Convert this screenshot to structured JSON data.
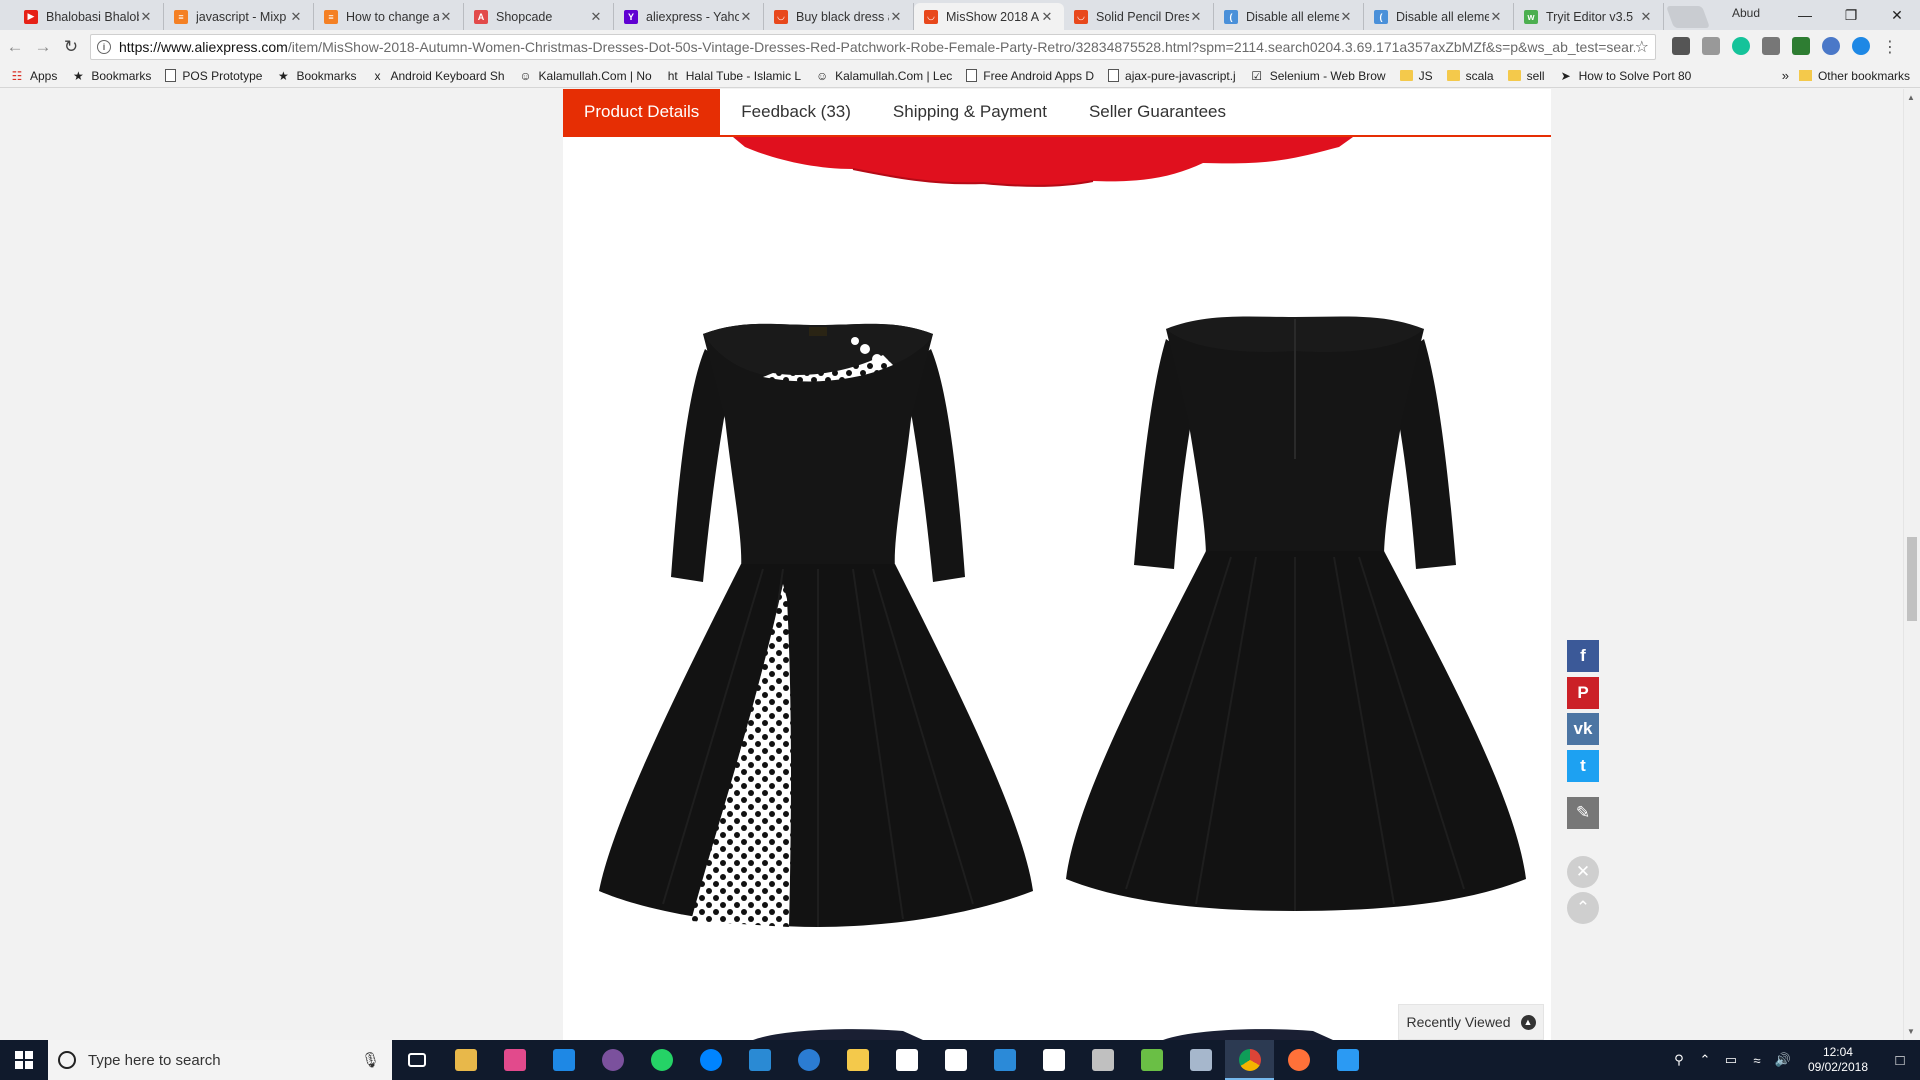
{
  "browser": {
    "tabs": [
      {
        "title": "Bhalobasi Bhalob",
        "color": "#e62117",
        "glyph": "▶"
      },
      {
        "title": "javascript - Mixp",
        "color": "#f48024",
        "glyph": "≡"
      },
      {
        "title": "How to change a",
        "color": "#f48024",
        "glyph": "≡"
      },
      {
        "title": "Shopcade",
        "color": "#e24a4a",
        "glyph": "A"
      },
      {
        "title": "aliexpress - Yaho",
        "color": "#6001d2",
        "glyph": "Y"
      },
      {
        "title": "Buy black dress a",
        "color": "#e8481c",
        "glyph": "◡"
      },
      {
        "title": "MisShow 2018 A",
        "color": "#e8481c",
        "glyph": "◡"
      },
      {
        "title": "Solid Pencil Dres",
        "color": "#e8481c",
        "glyph": "◡"
      },
      {
        "title": "Disable all eleme",
        "color": "#4a90d9",
        "glyph": "("
      },
      {
        "title": "Disable all eleme",
        "color": "#4a90d9",
        "glyph": "("
      },
      {
        "title": "Tryit Editor v3.5",
        "color": "#4caf50",
        "glyph": "w"
      }
    ],
    "active_tab_index": 6,
    "user": "Abud",
    "url_host": "https://www.aliexpress.com",
    "url_rest": "/item/MisShow-2018-Autumn-Women-Christmas-Dresses-Dot-50s-Vintage-Dresses-Red-Patchwork-Robe-Female-Party-Retro/32834875528.html?spm=2114.search0204.3.69.171a357axZbMZf&s=p&ws_ab_test=sear...",
    "bookmarks": [
      {
        "label": "Apps",
        "icon": "apps-icon"
      },
      {
        "label": "Bookmarks",
        "icon": "star-icon"
      },
      {
        "label": "POS Prototype",
        "icon": "page-icon"
      },
      {
        "label": "Bookmarks",
        "icon": "star-icon"
      },
      {
        "label": "Android Keyboard Sh",
        "icon": "xda-icon"
      },
      {
        "label": "Kalamullah.Com | No",
        "icon": "kalam-icon"
      },
      {
        "label": "Halal Tube - Islamic L",
        "icon": "ht-icon"
      },
      {
        "label": "Kalamullah.Com | Lec",
        "icon": "kalam-icon"
      },
      {
        "label": "Free Android Apps D",
        "icon": "page-icon"
      },
      {
        "label": "ajax-pure-javascript.j",
        "icon": "page-icon"
      },
      {
        "label": "Selenium - Web Brow",
        "icon": "selenium-icon"
      },
      {
        "label": "JS",
        "icon": "folder-icon"
      },
      {
        "label": "scala",
        "icon": "folder-icon"
      },
      {
        "label": "sell",
        "icon": "folder-icon"
      },
      {
        "label": "How to Solve Port 80",
        "icon": "arrow-icon"
      }
    ],
    "bookmarks_more": "»",
    "other_bookmarks": "Other bookmarks"
  },
  "page": {
    "tabs": [
      {
        "label": "Product Details",
        "active": true
      },
      {
        "label": "Feedback (33)",
        "active": false
      },
      {
        "label": "Shipping & Payment",
        "active": false
      },
      {
        "label": "Seller Guarantees",
        "active": false
      }
    ],
    "recently_viewed": "Recently Viewed",
    "share": [
      {
        "name": "facebook",
        "glyph": "f",
        "color": "#3b5998"
      },
      {
        "name": "pinterest",
        "glyph": "P",
        "color": "#cb2027"
      },
      {
        "name": "vk",
        "glyph": "vk",
        "color": "#4c75a3"
      },
      {
        "name": "twitter",
        "glyph": "t",
        "color": "#1da1f2"
      },
      {
        "name": "edit",
        "glyph": "✎",
        "color": "#777777"
      }
    ],
    "colors": {
      "accent": "#e62e04",
      "dress": "#111111",
      "dot_panel": "#ffffff",
      "red_dress": "#e0101e"
    }
  },
  "taskbar": {
    "search_placeholder": "Type here to search",
    "time": "12:04",
    "date": "09/02/2018",
    "apps": [
      {
        "name": "task-view-icon",
        "color": "#ffffff"
      },
      {
        "name": "file-store-icon",
        "color": "#e8b84a"
      },
      {
        "name": "paint-icon",
        "color": "#e24a8c"
      },
      {
        "name": "edge-icon",
        "color": "#1e88e5"
      },
      {
        "name": "viber-icon",
        "color": "#7b519d"
      },
      {
        "name": "whatsapp-icon",
        "color": "#25d366"
      },
      {
        "name": "messenger-icon",
        "color": "#0084ff"
      },
      {
        "name": "app-blue-icon",
        "color": "#2a8ad4"
      },
      {
        "name": "cloud-icon",
        "color": "#2b7cd3"
      },
      {
        "name": "explorer-icon",
        "color": "#f4c94b"
      },
      {
        "name": "settings-icon",
        "color": "#ffffff"
      },
      {
        "name": "mail-icon",
        "color": "#ffffff"
      },
      {
        "name": "store-icon",
        "color": "#2b8ad8"
      },
      {
        "name": "calculator-icon",
        "color": "#ffffff"
      },
      {
        "name": "vm-icon",
        "color": "#c0c0c0"
      },
      {
        "name": "notepad-icon",
        "color": "#6abf45"
      },
      {
        "name": "remote-icon",
        "color": "#a6b7cc"
      },
      {
        "name": "chrome-icon",
        "color": "#dd4b39"
      },
      {
        "name": "firefox-icon",
        "color": "#ff7139"
      },
      {
        "name": "vscode-icon",
        "color": "#2b9af3"
      }
    ],
    "active_app": "chrome-icon"
  }
}
